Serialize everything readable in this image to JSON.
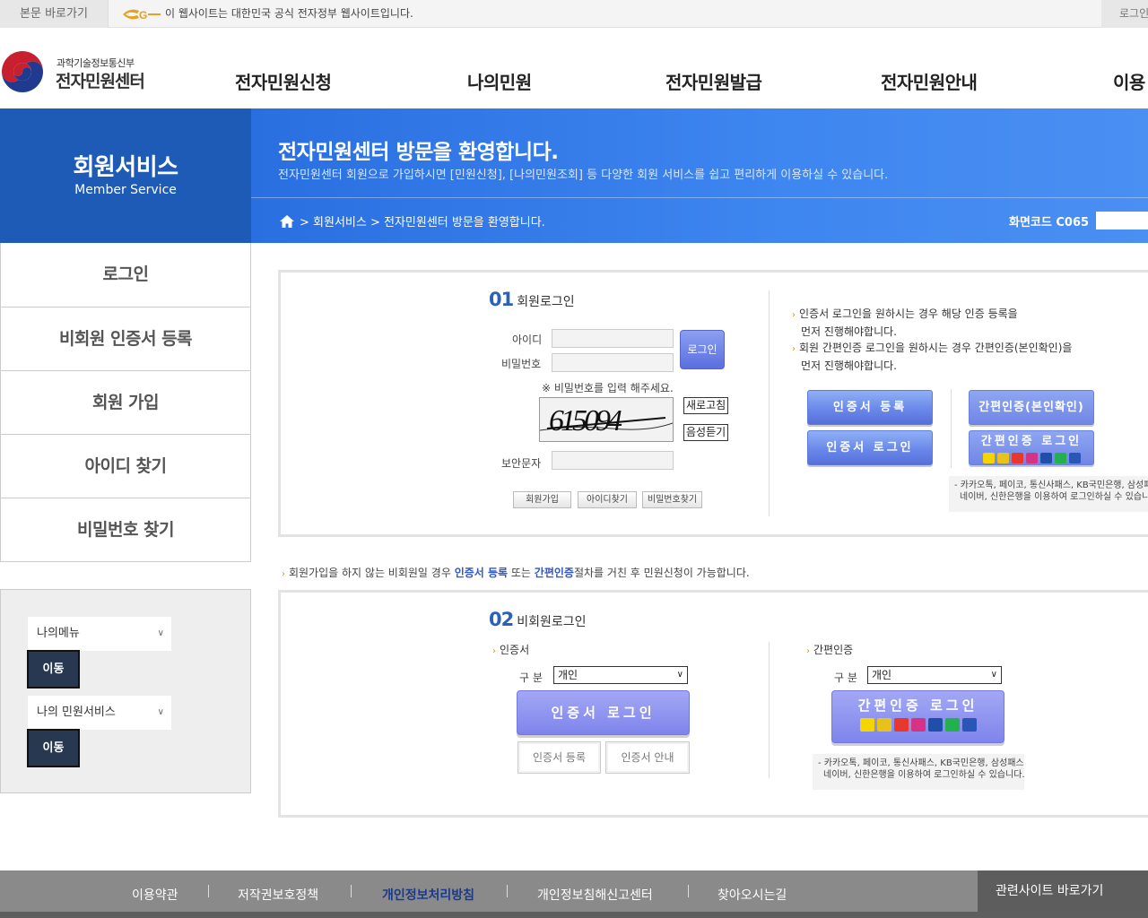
{
  "topbar": {
    "skip_link": "본문 바로가기",
    "gov_notice": "이 웹사이트는 대한민국 공식 전자정부 웹사이트입니다.",
    "login": "로그인"
  },
  "brand": {
    "ministry": "과학기술정보통신부",
    "site_name": "전자민원센터"
  },
  "gnb": [
    "전자민원신청",
    "나의민원",
    "전자민원발급",
    "전자민원안내",
    "이용"
  ],
  "hero": {
    "side_title": "회원서비스",
    "side_subtitle": "Member Service",
    "title": "전자민원센터 방문을 환영합니다.",
    "description": "전자민원센터 회원으로 가입하시면 [민원신청], [나의민원조회] 등 다양한 회원 서비스를 쉽고 편리하게 이용하실 수 있습니다.",
    "breadcrumb": "> 회원서비스 > 전자민원센터 방문을 환영합니다.",
    "screen_code": "화면코드 C065"
  },
  "side_menu": [
    "로그인",
    "비회원 인증서 등록",
    "회원 가입",
    "아이디 찾기",
    "비밀번호 찾기"
  ],
  "quick": {
    "select1": "나의메뉴",
    "select2": "나의 민원서비스",
    "go": "이동"
  },
  "member_login": {
    "num": "01",
    "title": "회원로그인",
    "id_label": "아이디",
    "pw_label": "비밀번호",
    "login_btn": "로그인",
    "pw_notice": "※ 비밀번호를 입력 해주세요.",
    "captcha_text": "615094",
    "refresh_btn": "새로고침",
    "audio_btn": "음성듣기",
    "captcha_label": "보안문자",
    "join_btn": "회원가입",
    "find_id_btn": "아이디찾기",
    "find_pw_btn": "비밀번호찾기",
    "bullet1_line1": "인증서 로그인을 원하시는 경우 해당 인증 등록을",
    "bullet1_line2": "먼저 진행해야합니다.",
    "bullet2_line1": "회원 간편인증 로그인을 원하시는 경우 간편인증(본인확인)을",
    "bullet2_line2": "먼저 진행해야합니다.",
    "cert_register": "인증서 등록",
    "cert_login": "인증서 로그인",
    "easy_verify": "간편인증(본인확인)",
    "easy_login": "간편인증 로그인",
    "info_line1": "- 카카오톡, 페이코, 통신사패스, KB국민은행, 삼성패스,",
    "info_line2": "네이버, 신한은행을 이용하여 로그인하실 수 있습니다."
  },
  "mid_notice": {
    "part1": "회원가입을 하지 않는 비회원일 경우 ",
    "hl1": "인증서 등록",
    "part2": " 또는 ",
    "hl2": "간편인증",
    "part3": "절차를 거친 후 민원신청이 가능합니다."
  },
  "nonmember_login": {
    "num": "02",
    "title": "비회원로그인",
    "cert_section": "인증서",
    "easy_section": "간편인증",
    "type_label": "구 분",
    "type_value": "개인",
    "cert_login": "인증서 로그인",
    "cert_register": "인증서 등록",
    "cert_guide": "인증서 안내",
    "easy_login": "간편인증 로그인",
    "info_line1": "- 카카오톡, 페이코, 통신사패스, KB국민은행, 삼성패스,",
    "info_line2": "네이버, 신한은행을 이용하여 로그인하실 수 있습니다."
  },
  "providers": [
    {
      "name": "kakao",
      "color": "#f5d400"
    },
    {
      "name": "payco",
      "color": "#e8c21a"
    },
    {
      "name": "pass",
      "color": "#e8372c"
    },
    {
      "name": "kb",
      "color": "#f28c1a"
    },
    {
      "name": "samsung",
      "color": "#1f4fa8"
    },
    {
      "name": "naver",
      "color": "#22b14c"
    },
    {
      "name": "shinhan",
      "color": "#2a56b8"
    }
  ],
  "footer": {
    "links": [
      "이용약관",
      "저작권보호정책",
      "개인정보처리방침",
      "개인정보침해신고센터",
      "찾아오시는길"
    ],
    "related": "관련사이트 바로가기"
  },
  "colors": {
    "hero_dark": "#1e5bb7",
    "hero_light": "#3e86f0",
    "accent_blue": "#2a62b8",
    "footer_grey": "#8a8a8a",
    "privacy_link": "#1a3a8c"
  }
}
